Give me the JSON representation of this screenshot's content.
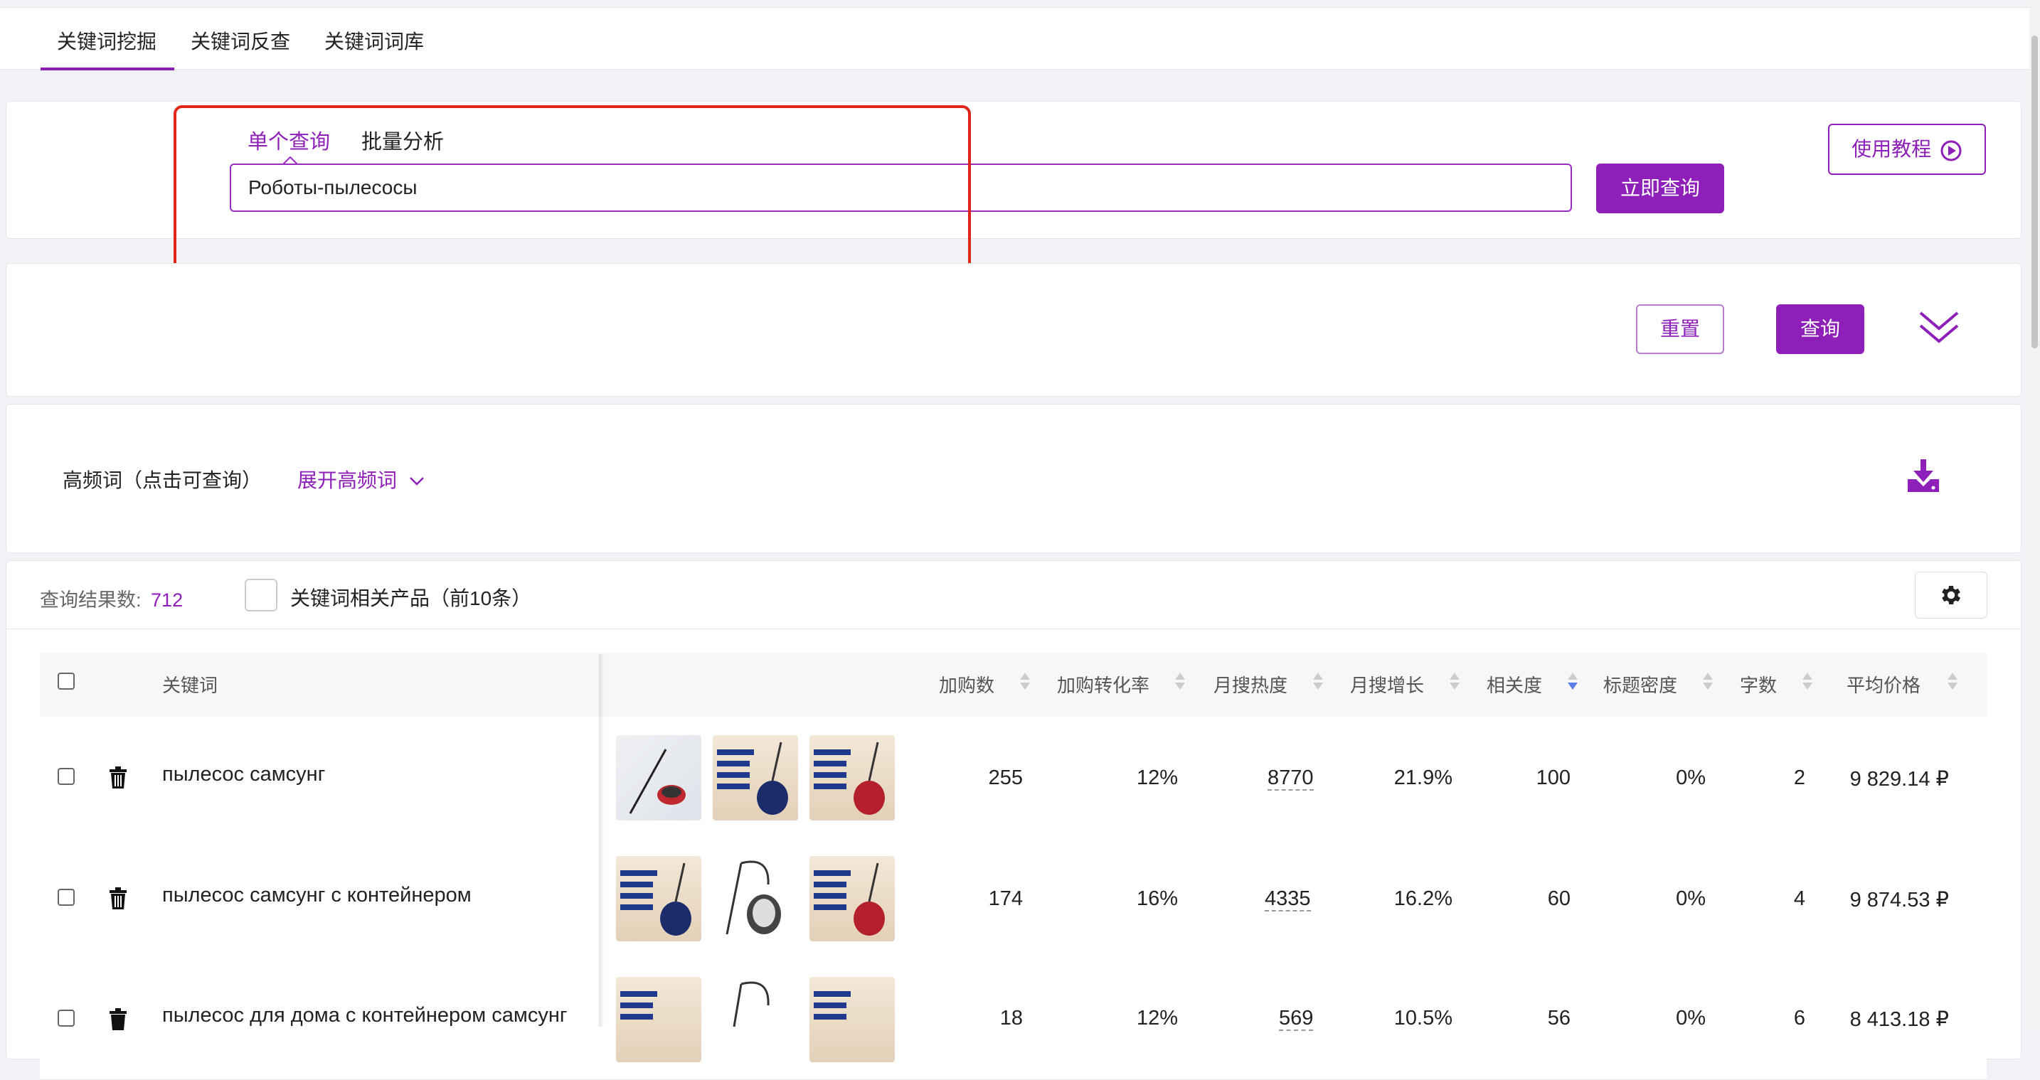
{
  "top_tabs": [
    {
      "label": "关键词挖掘",
      "active": true
    },
    {
      "label": "关键词反查",
      "active": false
    },
    {
      "label": "关键词词库",
      "active": false
    }
  ],
  "search": {
    "tabs": [
      {
        "label": "单个查询",
        "active": true
      },
      {
        "label": "批量分析",
        "active": false
      }
    ],
    "input_value": "Роботы-пылесосы",
    "submit_label": "立即查询",
    "tutorial_label": "使用教程"
  },
  "filters": {
    "reset_label": "重置",
    "query_label": "查询"
  },
  "high_freq": {
    "label": "高频词（点击可查询）",
    "expand_label": "展开高频词"
  },
  "results": {
    "count_label": "查询结果数:",
    "count_value": "712",
    "related_products_label": "关键词相关产品（前10条）"
  },
  "table": {
    "columns": [
      "关键词",
      "加购数",
      "加购转化率",
      "月搜热度",
      "月搜增长",
      "相关度",
      "标题密度",
      "字数",
      "平均价格"
    ],
    "rows": [
      {
        "keyword": "пылесос самсунг",
        "add_to_cart": "255",
        "cart_rate": "12%",
        "monthly_search": "8770",
        "monthly_growth": "21.9%",
        "relevance": "100",
        "title_density": "0%",
        "word_count": "2",
        "avg_price": "9 829.14 ₽"
      },
      {
        "keyword": "пылесос самсунг с контейнером",
        "add_to_cart": "174",
        "cart_rate": "16%",
        "monthly_search": "4335",
        "monthly_growth": "16.2%",
        "relevance": "60",
        "title_density": "0%",
        "word_count": "4",
        "avg_price": "9 874.53 ₽"
      },
      {
        "keyword": "пылесос для дома с контейнером самсунг",
        "add_to_cart": "18",
        "cart_rate": "12%",
        "monthly_search": "569",
        "monthly_growth": "10.5%",
        "relevance": "56",
        "title_density": "0%",
        "word_count": "6",
        "avg_price": "8 413.18 ₽"
      }
    ]
  },
  "colors": {
    "accent": "#8e1fb9",
    "highlight_box": "#e0261b"
  }
}
